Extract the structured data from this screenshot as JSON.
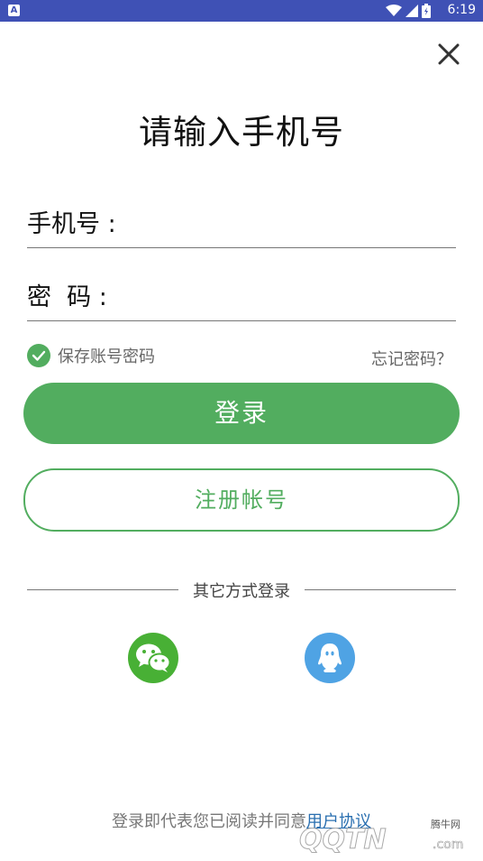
{
  "status_bar": {
    "notification_icon": "A",
    "time": "6:19",
    "icons": [
      "wifi-icon",
      "signal-icon",
      "battery-icon"
    ]
  },
  "header": {
    "close_icon": "close-icon",
    "title": "请输入手机号"
  },
  "form": {
    "phone_label": "手机号 :",
    "phone_value": "",
    "password_label": "密  码 :",
    "password_value": ""
  },
  "options": {
    "remember_label": "保存账号密码",
    "remember_checked": true,
    "forgot_label": "忘记密码？"
  },
  "buttons": {
    "login_label": "登录",
    "register_label": "注册帐号"
  },
  "other_login": {
    "divider_text": "其它方式登录",
    "providers": [
      "wechat-icon",
      "qq-icon"
    ]
  },
  "footer": {
    "agreement_text": "登录即代表您已阅读并同意",
    "agreement_link": "用户协议"
  },
  "watermark": {
    "small_text": "腾牛网",
    "logo_text": "QQTN",
    "domain": ".com"
  },
  "colors": {
    "accent": "#52ad5f",
    "status_bar": "#3f51b5",
    "link": "#2a6fb0",
    "qq_blue": "#4fa3e4",
    "wechat_green": "#48b035"
  }
}
